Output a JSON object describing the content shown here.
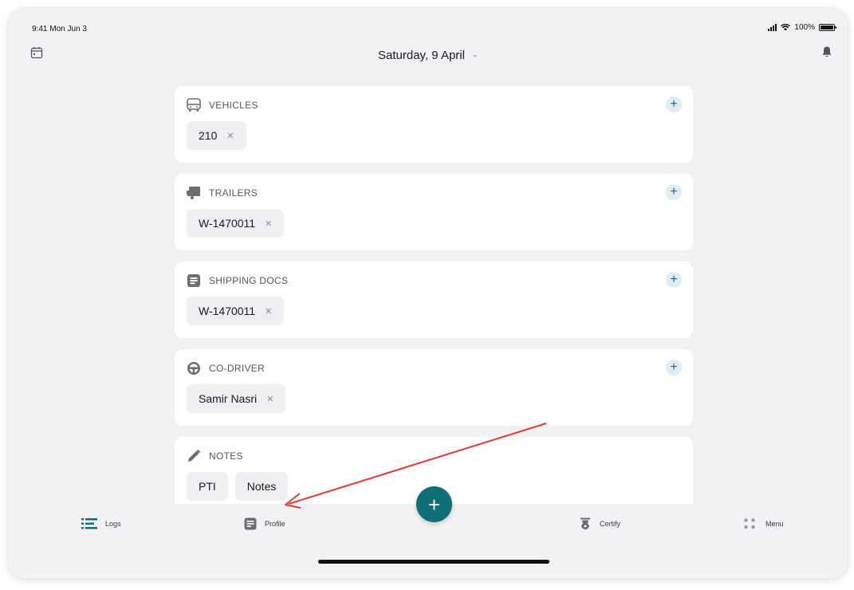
{
  "status_bar": {
    "time": "9:41 Mon Jun 3",
    "battery": "100%"
  },
  "header": {
    "date": "Saturday, 9 April"
  },
  "cards": [
    {
      "title": "VEHICLES",
      "icon": "bus-icon",
      "chips": [
        "210"
      ]
    },
    {
      "title": "TRAILERS",
      "icon": "trailer-icon",
      "chips": [
        "W-1470011"
      ]
    },
    {
      "title": "SHIPPING DOCS",
      "icon": "document-icon",
      "chips": [
        "W-1470011"
      ]
    },
    {
      "title": "CO-DRIVER",
      "icon": "steering-wheel-icon",
      "chips": [
        "Samir Nasri"
      ]
    },
    {
      "title": "NOTES",
      "icon": "pencil-icon",
      "chips": [
        "PTI",
        "Notes"
      ]
    }
  ],
  "tabs": {
    "logs": "Logs",
    "profile": "Profile",
    "certify": "Certify",
    "menu": "Menu"
  },
  "colors": {
    "accent": "#0f6e78",
    "annotation": "#e53935"
  }
}
